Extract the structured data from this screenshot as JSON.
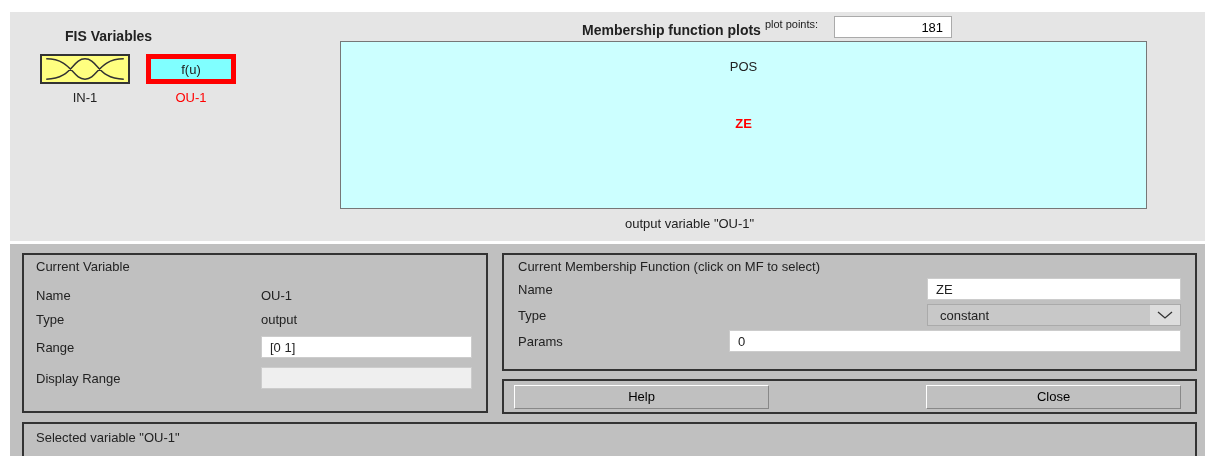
{
  "fis_variables": {
    "title": "FIS Variables",
    "items": [
      {
        "name": "IN-1",
        "kind": "input",
        "selected": false
      },
      {
        "name": "OU-1",
        "kind": "output",
        "symbol": "f(u)",
        "selected": true
      }
    ]
  },
  "plot": {
    "title": "Membership function plots",
    "plot_points_label": "plot points:",
    "plot_points": "181",
    "mfs": [
      {
        "name": "POS",
        "selected": false
      },
      {
        "name": "ZE",
        "selected": true
      }
    ],
    "caption": "output variable \"OU-1\""
  },
  "current_variable": {
    "title": "Current Variable",
    "name_label": "Name",
    "name": "OU-1",
    "type_label": "Type",
    "type": "output",
    "range_label": "Range",
    "range": "[0 1]",
    "display_range_label": "Display Range",
    "display_range_disabled": true
  },
  "current_mf": {
    "title": "Current Membership Function (click on MF to select)",
    "name_label": "Name",
    "name": "ZE",
    "type_label": "Type",
    "type": "constant",
    "params_label": "Params",
    "params": "0"
  },
  "buttons": [
    "Help",
    "Close"
  ],
  "status": "Selected variable \"OU-1\""
}
